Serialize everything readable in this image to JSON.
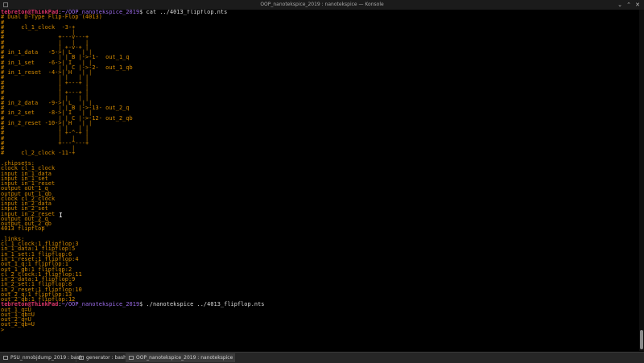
{
  "window": {
    "title": "OOP_nanotekspice_2019 : nanotekspice — Konsole"
  },
  "terminal": {
    "lines": [
      {
        "k": "prompt",
        "user": "tebreton@ThinkPad",
        "path": "~/OOP_nanotekspice_2019",
        "rest": "$ cat ../4013_flipflop.nts"
      },
      {
        "k": "out",
        "t": "# Dual D-Type Flip-Flop (4013)"
      },
      {
        "k": "out",
        "t": "#"
      },
      {
        "k": "out",
        "t": "#     cl_1_clock  -3-+"
      },
      {
        "k": "out",
        "t": "#                    |"
      },
      {
        "k": "out",
        "t": "#                +---v---+"
      },
      {
        "k": "out",
        "t": "#                |   |   |"
      },
      {
        "k": "out",
        "t": "#                | +-v-+ |"
      },
      {
        "k": "out",
        "t": "# in_1_data   -5->| L   | |"
      },
      {
        "k": "out",
        "t": "#                | | B |->-1-  out_1_q"
      },
      {
        "k": "out",
        "t": "# in_1_set    -6->| I   | |"
      },
      {
        "k": "out",
        "t": "#                | | C |->-2-  out_1_qb"
      },
      {
        "k": "out",
        "t": "# in_1_reset  -4->| H   | |"
      },
      {
        "k": "out",
        "t": "#                | |   | |"
      },
      {
        "k": "out",
        "t": "#                | +---+ |"
      },
      {
        "k": "out",
        "t": "#                |       |"
      },
      {
        "k": "out",
        "t": "#                | +---+ |"
      },
      {
        "k": "out",
        "t": "#                | |   | |"
      },
      {
        "k": "out",
        "t": "# in_2_data   -9->| L   | |"
      },
      {
        "k": "out",
        "t": "#                | | B |->-13- out_2_q"
      },
      {
        "k": "out",
        "t": "# in_2_set    -8->| I   | |"
      },
      {
        "k": "out",
        "t": "#                | | C |->-12- out_2_qb"
      },
      {
        "k": "out",
        "t": "# in_2_reset -10->| H   | |"
      },
      {
        "k": "out",
        "t": "#                | |   | |"
      },
      {
        "k": "out",
        "t": "#                | +-^-+ |"
      },
      {
        "k": "out",
        "t": "#                |   |   |"
      },
      {
        "k": "out",
        "t": "#                +---^---+"
      },
      {
        "k": "out",
        "t": "#                    |"
      },
      {
        "k": "out",
        "t": "#     cl_2_clock -11-+"
      },
      {
        "k": "out",
        "t": ""
      },
      {
        "k": "out",
        "t": ".chipsets:"
      },
      {
        "k": "out",
        "t": "clock cl_1_clock"
      },
      {
        "k": "out",
        "t": "input in_1_data"
      },
      {
        "k": "out",
        "t": "input in_1_set"
      },
      {
        "k": "out",
        "t": "input in_1_reset"
      },
      {
        "k": "out",
        "t": "output out_1_q"
      },
      {
        "k": "out",
        "t": "output out_1_qb"
      },
      {
        "k": "out",
        "t": "clock cl_2_clock"
      },
      {
        "k": "out",
        "t": "input in_2_data"
      },
      {
        "k": "out",
        "t": "input in_2_set"
      },
      {
        "k": "out",
        "t": "input in_2_reset"
      },
      {
        "k": "out",
        "t": "output out_2_q"
      },
      {
        "k": "out",
        "t": "output out_2_qb"
      },
      {
        "k": "out",
        "t": "4013 flipflop"
      },
      {
        "k": "out",
        "t": ""
      },
      {
        "k": "out",
        "t": ".links:"
      },
      {
        "k": "out",
        "t": "cl_1_clock:1 flipflop:3"
      },
      {
        "k": "out",
        "t": "in_1_data:1 flipflop:5"
      },
      {
        "k": "out",
        "t": "in_1_set:1 flipflop:6"
      },
      {
        "k": "out",
        "t": "in_1_reset:1 flipflop:4"
      },
      {
        "k": "out",
        "t": "out_1_q:1 flipflop:1"
      },
      {
        "k": "out",
        "t": "out_1_qb:1 flipflop:2"
      },
      {
        "k": "out",
        "t": "cl_2_clock:1 flipflop:11"
      },
      {
        "k": "out",
        "t": "in_2_data:1 flipflop:9"
      },
      {
        "k": "out",
        "t": "in_2_set:1 flipflop:8"
      },
      {
        "k": "out",
        "t": "in_2_reset:1 flipflop:10"
      },
      {
        "k": "out",
        "t": "out_2_q:1 flipflop:13"
      },
      {
        "k": "out",
        "t": "out_2_qb:1 flipflop:12"
      },
      {
        "k": "prompt",
        "user": "tebreton@ThinkPad",
        "path": "~/OOP_nanotekspice_2019",
        "rest": "$ ./nanotekspice ../4013_flipflop.nts"
      },
      {
        "k": "out",
        "t": "out_1_q=U"
      },
      {
        "k": "out",
        "t": "out_1_qb=U"
      },
      {
        "k": "out",
        "t": "out_2_q=U"
      },
      {
        "k": "out",
        "t": "out_2_qb=U"
      },
      {
        "k": "out",
        "t": "> "
      }
    ]
  },
  "tabs": [
    {
      "label": "PSU_nmobjdump_2019 : bash"
    },
    {
      "label": "generator : bash"
    },
    {
      "label": "OOP_nanotekspice_2019 : nanotekspice"
    }
  ],
  "colors": {
    "prompt_user": "#e0386d",
    "prompt_path": "#9b6be8",
    "output": "#d48a00",
    "background": "#000000"
  }
}
